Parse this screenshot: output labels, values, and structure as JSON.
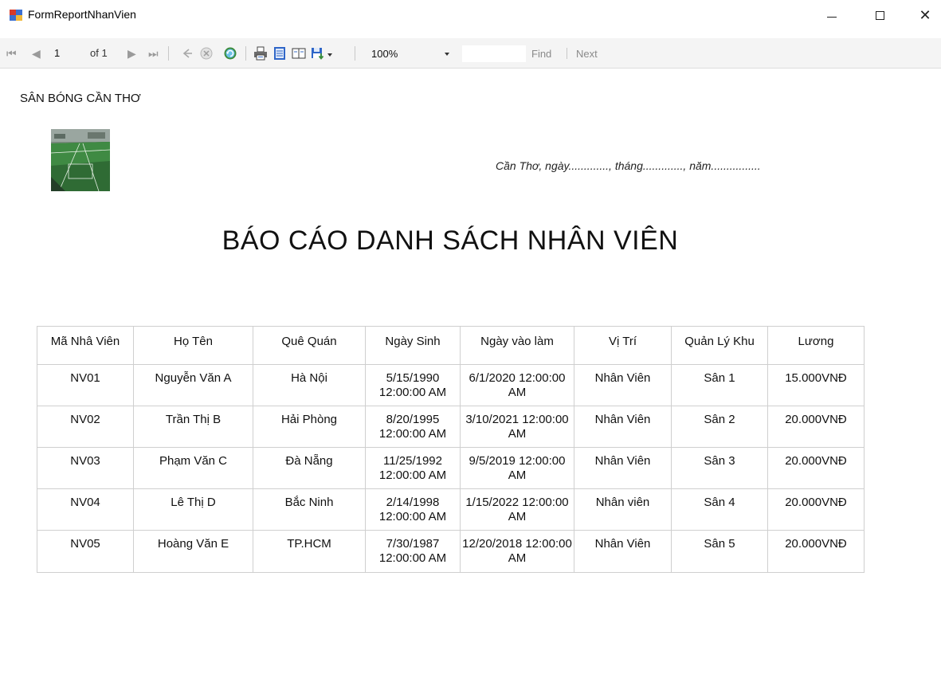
{
  "window": {
    "title": "FormReportNhanVien",
    "minimize_glyph": "—",
    "maximize_glyph": "☐",
    "close_glyph": "✕"
  },
  "toolbar": {
    "current_page": "1",
    "page_of": "of 1",
    "zoom": "100%",
    "find_label": "Find",
    "next_label": "Next",
    "icons": [
      "first-page-icon",
      "previous-page-icon",
      "next-page-icon",
      "last-page-icon",
      "back-icon",
      "stop-icon",
      "refresh-icon",
      "print-icon",
      "print-layout-icon",
      "page-setup-icon",
      "export-icon"
    ]
  },
  "report": {
    "organization": "SÂN BÓNG CẦN THƠ",
    "place_date": "Cần Thơ, ngày............., tháng............., năm................",
    "title": "BÁO CÁO DANH SÁCH NHÂN VIÊN",
    "columns": [
      "Mã Nhâ Viên",
      "Họ Tên",
      "Quê Quán",
      "Ngày Sinh",
      "Ngày vào làm",
      "Vị Trí",
      "Quản Lý Khu",
      "Lương"
    ],
    "rows": [
      [
        "NV01",
        "Nguyễn Văn A",
        "Hà Nội",
        "5/15/1990 12:00:00 AM",
        "6/1/2020 12:00:00 AM",
        "Nhân Viên",
        "Sân 1",
        "15.000VNĐ"
      ],
      [
        "NV02",
        "Trần Thị B",
        "Hải Phòng",
        "8/20/1995 12:00:00 AM",
        "3/10/2021 12:00:00 AM",
        "Nhân Viên",
        "Sân 2",
        "20.000VNĐ"
      ],
      [
        "NV03",
        "Phạm Văn C",
        "Đà Nẵng",
        "11/25/1992 12:00:00 AM",
        "9/5/2019 12:00:00 AM",
        "Nhân Viên",
        "Sân 3",
        "20.000VNĐ"
      ],
      [
        "NV04",
        "Lê Thị D",
        "Bắc Ninh",
        "2/14/1998 12:00:00 AM",
        "1/15/2022 12:00:00 AM",
        "Nhân viên",
        "Sân 4",
        "20.000VNĐ"
      ],
      [
        "NV05",
        "Hoàng Văn E",
        "TP.HCM",
        "7/30/1987 12:00:00 AM",
        "12/20/2018 12:00:00 AM",
        "Nhân Viên",
        "Sân 5",
        "20.000VNĐ"
      ]
    ]
  }
}
